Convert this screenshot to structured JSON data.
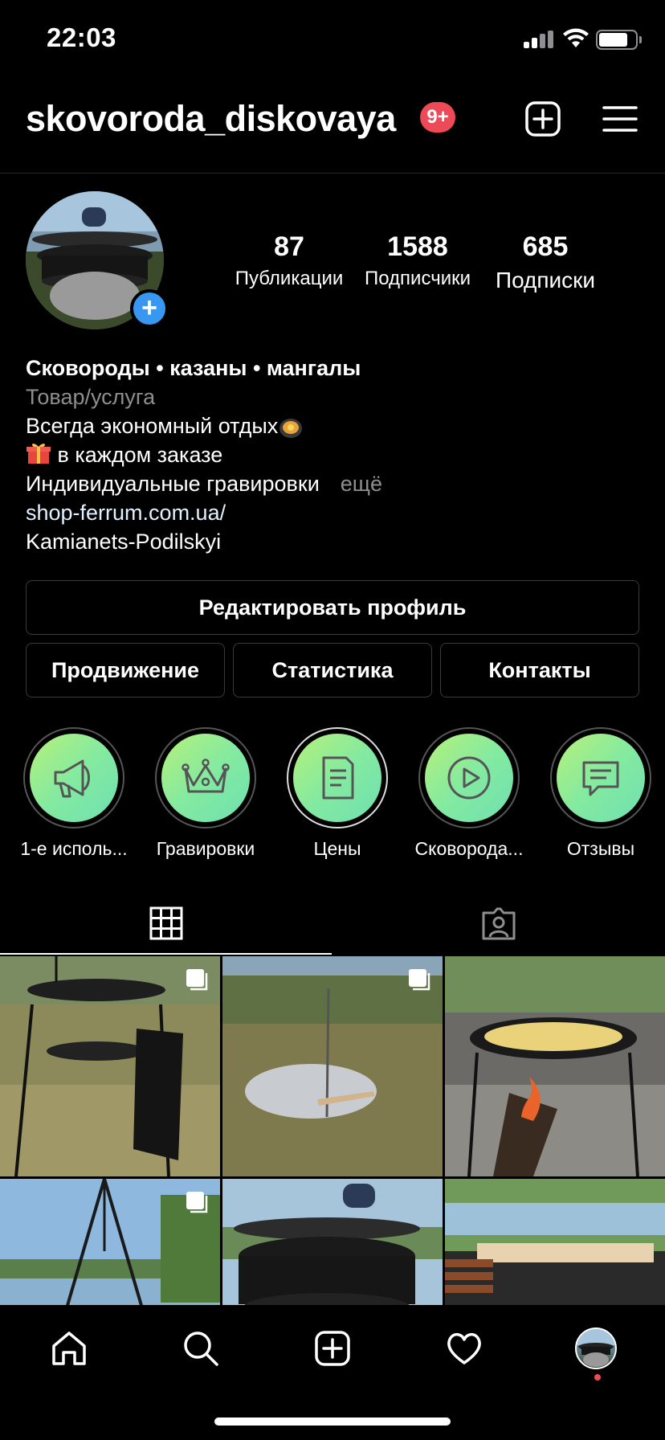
{
  "status_bar": {
    "time": "22:03",
    "battery_level": 0.8
  },
  "header": {
    "username": "skovoroda_diskovaya",
    "notification_badge": "9+",
    "new_post_icon": "plus-square-icon",
    "menu_icon": "hamburger-menu-icon"
  },
  "profile": {
    "stats": [
      {
        "value": "87",
        "label": "Публикации"
      },
      {
        "value": "1588",
        "label": "Подписчики"
      },
      {
        "value": "685",
        "label": "Подписки"
      }
    ],
    "bio": {
      "name": "Сковороды • казаны • мангалы",
      "category": "Товар/услуга",
      "line1": "Всегда экономный отдых",
      "line2": " в каждом заказе",
      "line3": "Индивидуальные гравировки",
      "more": "ещё",
      "website": "shop-ferrum.com.ua/",
      "location": "Kamianets-Podilskyi"
    }
  },
  "buttons": {
    "edit_profile": "Редактировать профиль",
    "promotion": "Продвижение",
    "statistics": "Статистика",
    "contacts": "Контакты"
  },
  "highlights": [
    {
      "label": "1-е исполь...",
      "icon": "megaphone-icon"
    },
    {
      "label": "Гравировки",
      "icon": "crown-icon"
    },
    {
      "label": "Цены",
      "icon": "document-icon"
    },
    {
      "label": "Сковорода...",
      "icon": "play-icon"
    },
    {
      "label": "Отзывы",
      "icon": "chat-bubble-icon"
    }
  ],
  "tabs": [
    {
      "name": "grid",
      "icon": "grid-icon",
      "active": true
    },
    {
      "name": "tagged",
      "icon": "tagged-person-icon",
      "active": false
    }
  ],
  "posts": [
    {
      "multi": true
    },
    {
      "multi": true
    },
    {
      "multi": false
    },
    {
      "multi": true
    },
    {
      "multi": false
    },
    {
      "multi": false
    }
  ],
  "bottom_nav": [
    "home-icon",
    "search-icon",
    "new-post-icon",
    "activity-heart-icon",
    "profile-avatar"
  ],
  "colors": {
    "background": "#000000",
    "badge": "#ed4956",
    "accent": "#3897f0",
    "highlight_green": "#9ef08a"
  }
}
